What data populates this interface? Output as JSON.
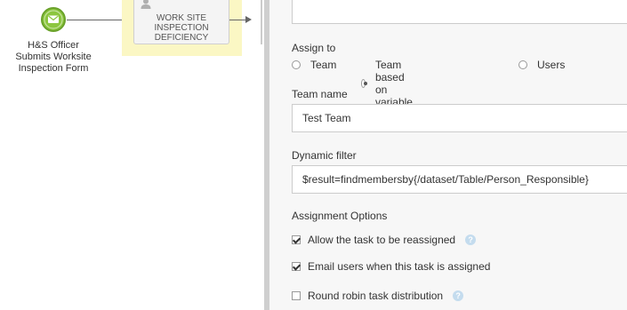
{
  "diagram": {
    "start_event": {
      "label": "H&S Officer\nSubmits Worksite\nInspection Form",
      "icon": "envelope-icon",
      "color": "#8cc63f"
    },
    "task": {
      "title": "WORK SITE\nINSPECTION\nDEFICIENCY",
      "icon": "user-icon",
      "highlight_color": "#fbf7c4"
    }
  },
  "panel": {
    "assign_to": {
      "label": "Assign to",
      "options": [
        {
          "label": "Team",
          "selected": false
        },
        {
          "label": "Team based on variable",
          "selected": true
        },
        {
          "label": "Users",
          "selected": false
        }
      ]
    },
    "team_name": {
      "label": "Team name",
      "value": "Test Team"
    },
    "dynamic_filter": {
      "label": "Dynamic filter",
      "value": "$result=findmembersby{/dataset/Table/Person_Responsible}"
    },
    "assignment_options": {
      "label": "Assignment Options",
      "items": [
        {
          "label": "Allow the task to be reassigned",
          "checked": true,
          "help": true
        },
        {
          "label": "Email users when this task is assigned",
          "checked": true,
          "help": false
        },
        {
          "label": "Round robin task distribution",
          "checked": false,
          "help": true
        }
      ]
    }
  }
}
